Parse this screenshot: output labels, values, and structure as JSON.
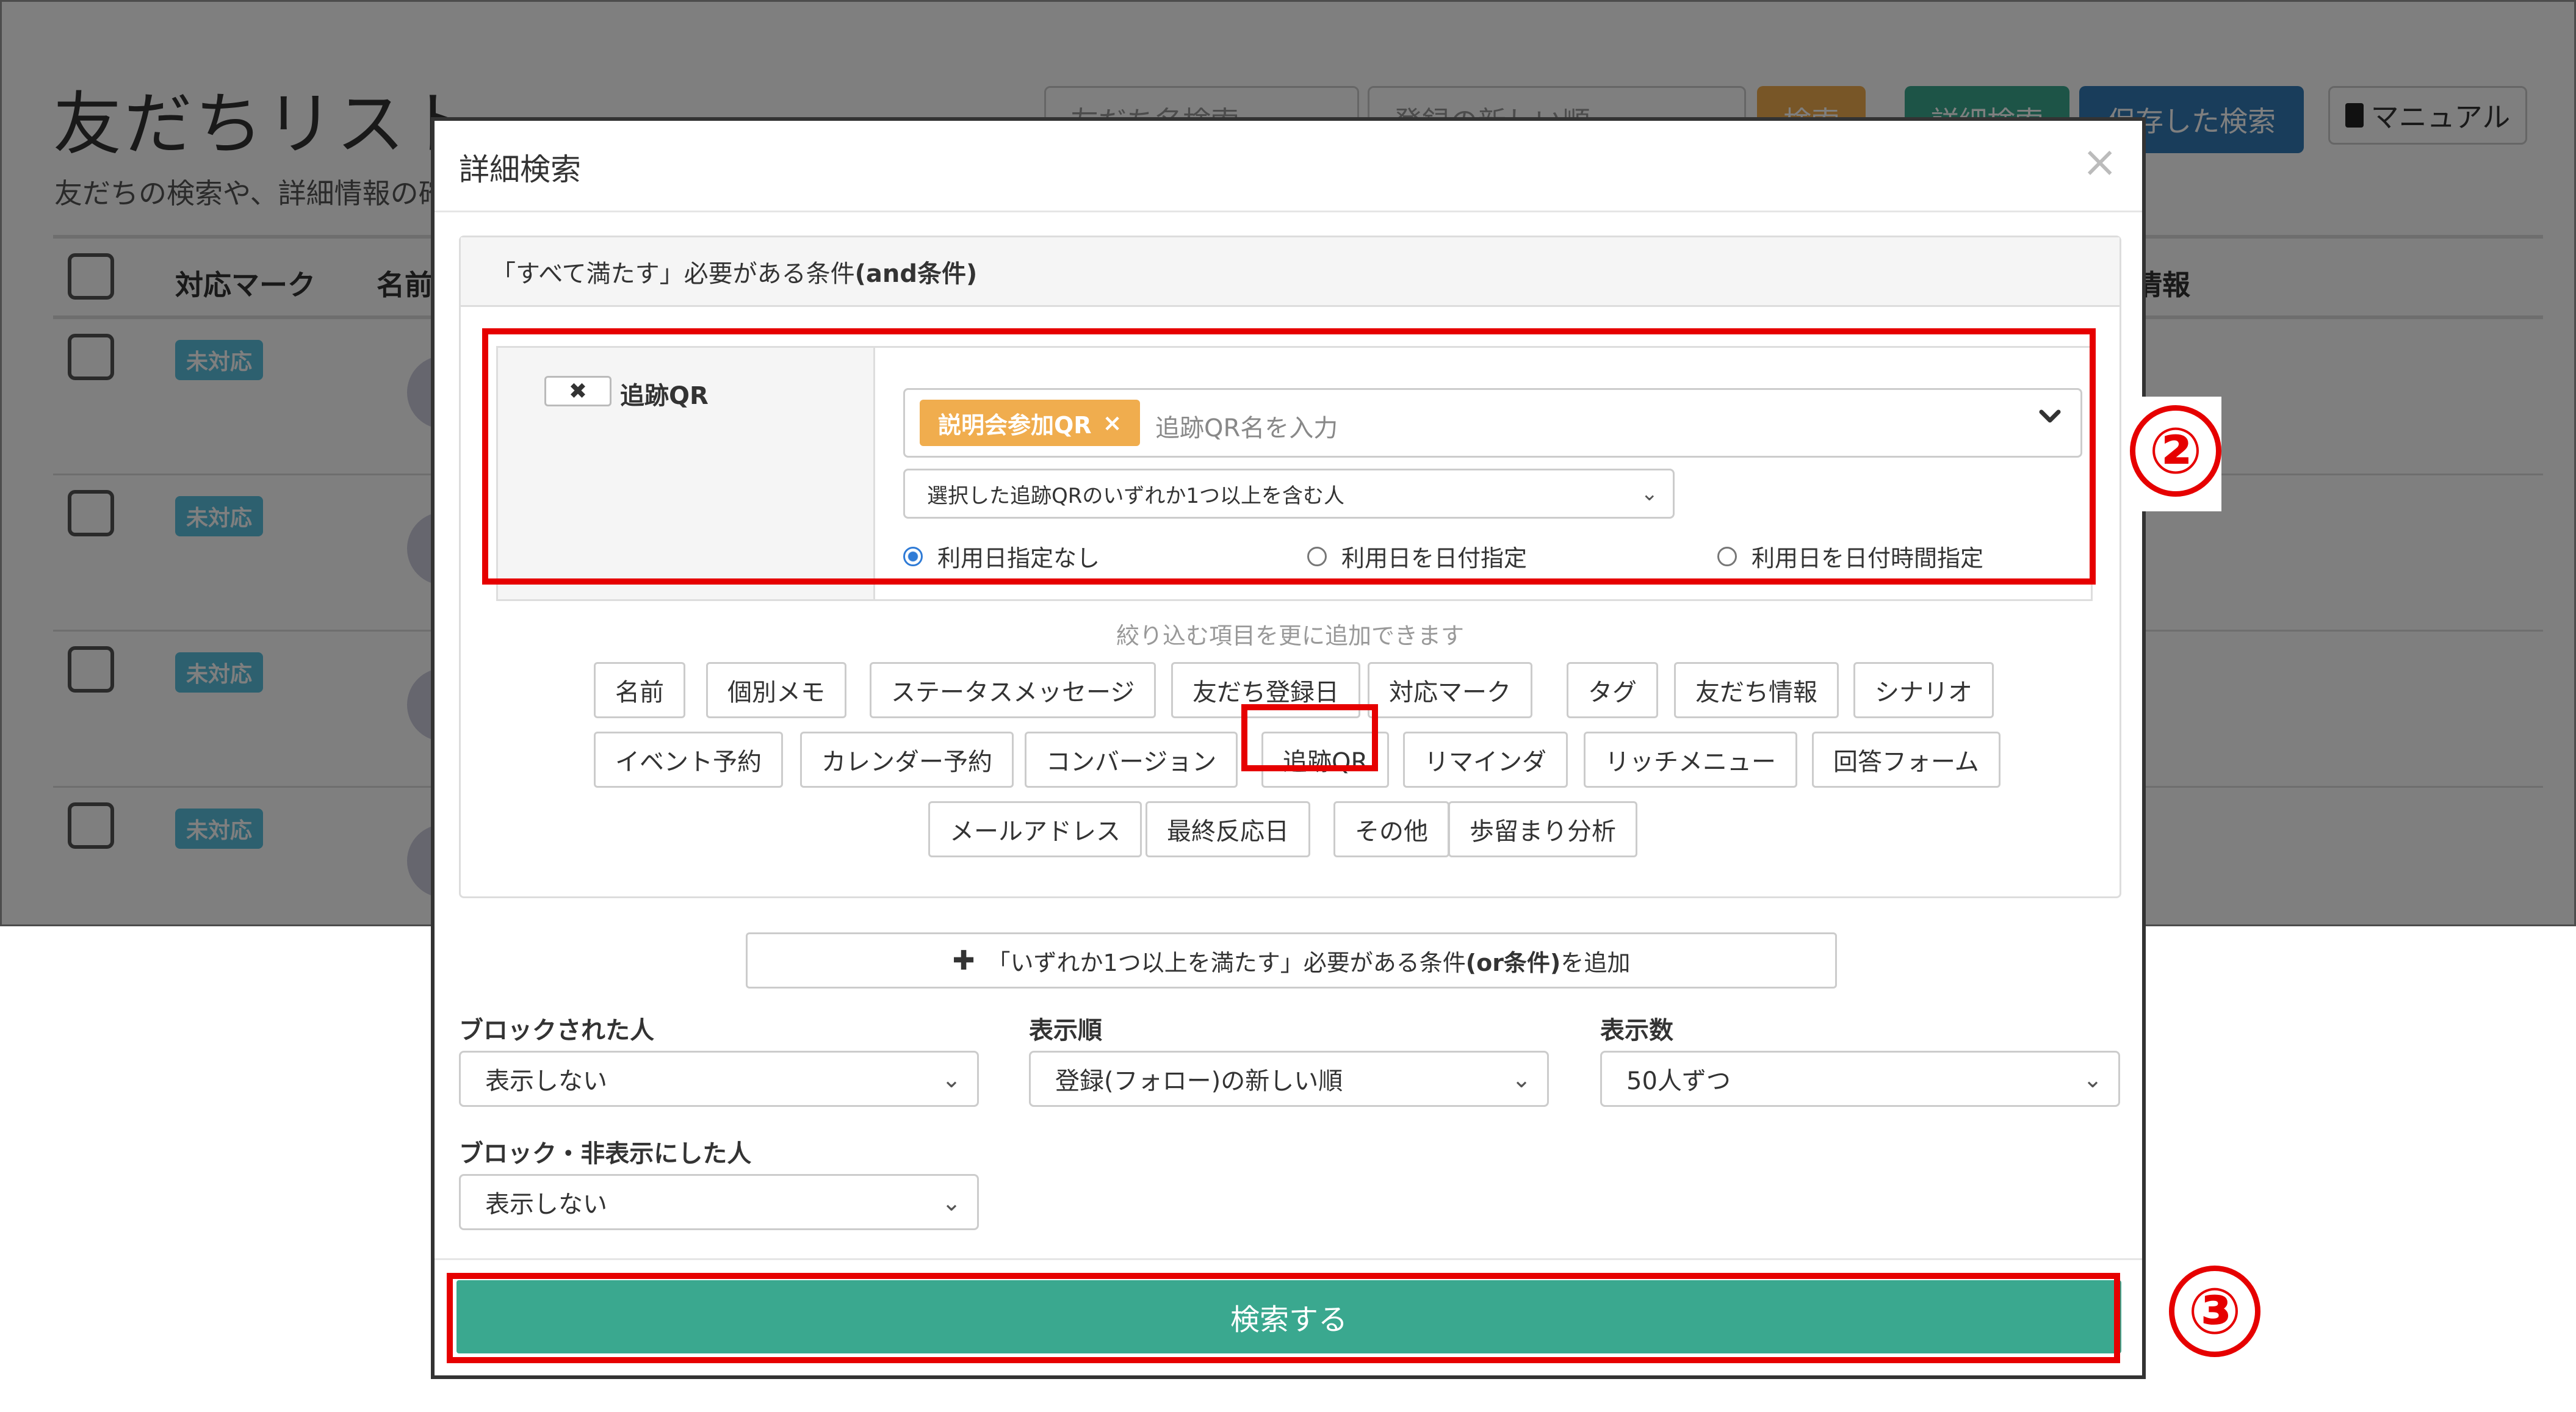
{
  "background": {
    "page_title": "友だちリスト",
    "subtitle": "友だちの検索や、詳細情報の確",
    "search_placeholder": "友だち名検索",
    "sort_value": "登録の新しい順",
    "search_button": "検索",
    "detail_search_button": "詳細検索",
    "saved_search_button": "保存した検索",
    "manual_button": "マニュアル",
    "columns": [
      "対応マーク",
      "名前",
      "情報"
    ],
    "rows": [
      {
        "badge": "未対応"
      },
      {
        "badge": "未対応"
      },
      {
        "badge": "未対応"
      },
      {
        "badge": "未対応"
      }
    ]
  },
  "modal": {
    "title": "詳細検索",
    "close_glyph": "×",
    "and_section": {
      "heading_prefix": "「すべて満たす」必要がある条件 ",
      "heading_bold": "(and条件)",
      "condition": {
        "remove_glyph": "✖",
        "label": "追跡QR",
        "chip_label": "説明会参加QR",
        "chip_remove": "×",
        "tag_placeholder": "追跡QR名を入力",
        "match_mode": "選択した追跡QRのいずれか1つ以上を含む人",
        "radio_options": [
          {
            "label": "利用日指定なし",
            "checked": true
          },
          {
            "label": "利用日を日付指定",
            "checked": false
          },
          {
            "label": "利用日を日付時間指定",
            "checked": false
          }
        ]
      },
      "hint": "絞り込む項目を更に追加できます",
      "filter_buttons": [
        "名前",
        "個別メモ",
        "ステータスメッセージ",
        "友だち登録日",
        "対応マーク",
        "タグ",
        "友だち情報",
        "シナリオ",
        "イベント予約",
        "カレンダー予約",
        "コンバージョン",
        "追跡QR",
        "リマインダ",
        "リッチメニュー",
        "回答フォーム",
        "メールアドレス",
        "最終反応日",
        "その他",
        "歩留まり分析"
      ]
    },
    "or_add": {
      "prefix": "「いずれか1つ以上を満たす」必要がある条件",
      "bold": "(or条件)",
      "suffix": "を追加"
    },
    "fields": {
      "blocked_label": "ブロックされた人",
      "blocked_value": "表示しない",
      "order_label": "表示順",
      "order_value": "登録(フォロー)の新しい順",
      "count_label": "表示数",
      "count_value": "50人ずつ",
      "hidden_label": "ブロック・非表示にした人",
      "hidden_value": "表示しない"
    },
    "search_button": "検索する"
  },
  "annotations": {
    "step2": "②",
    "step3": "③",
    "color": "#e60000"
  },
  "colors": {
    "accent_green": "#3aa88f",
    "chip_orange": "#f0ad4e",
    "badge_blue": "#5bc0de",
    "saved_blue": "#337ab7"
  }
}
